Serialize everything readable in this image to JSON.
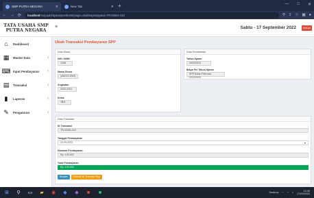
{
  "browser": {
    "tabs": [
      {
        "label": "SMP PUTRA NEGARA"
      },
      {
        "label": "New Tab"
      }
    ],
    "url_host": "localhost",
    "url_path": "/mejupdd/ajukanpnvtlnvtbr/page=ubahbayarspp&id=TR-00081-922",
    "icons": {
      "back": "←",
      "forward": "→",
      "reload": "⟳",
      "new_tab": "+",
      "minimize": "—",
      "maximize": "□",
      "close": "✕"
    }
  },
  "app": {
    "logo_line1": "TATA USAHA SMP",
    "logo_line2": "PUTRA NEGARA",
    "datetime": "Sabtu - 17 September 2022",
    "logout_label": "Keluar"
  },
  "sidebar": {
    "items": [
      {
        "label": "Dashboard",
        "icon": "home-icon"
      },
      {
        "label": "Master Data",
        "icon": "grid-icon"
      },
      {
        "label": "Input Pembayaran",
        "icon": "keyboard-icon"
      },
      {
        "label": "Transaksi",
        "icon": "money-icon"
      },
      {
        "label": "Laporan",
        "icon": "file-icon"
      },
      {
        "label": "Pengaturan",
        "icon": "wrench-icon"
      }
    ]
  },
  "main": {
    "title": "Ubah Transaksi Pembayaran SPP",
    "data_siswa": {
      "header": "Data Siswa",
      "nis_label": "NIS / NISN",
      "nis_value": "1248",
      "nama_label": "Nama Siswa",
      "nama_value": "(ANGGI DWI)",
      "angkatan_label": "Angkatan",
      "angkatan_value": "2020-2021",
      "kelas_label": "Kelas",
      "kelas_value": "7B/4"
    },
    "data_pendaftaran": {
      "header": "Data Pendaftaran",
      "tahun_label": "Tahun Ajaran",
      "tahun_value": "2022/2023",
      "biaya_label": "Biaya Per Tahun Ajaran",
      "biaya_value": "SPP Bulan Februari 2022/2023"
    },
    "data_transaksi": {
      "header": "Data Transaksi",
      "id_label": "ID Transaksi",
      "id_value": "TR-00081-922",
      "tanggal_label": "Tanggal Pembayaran",
      "tanggal_value": "22-09-2022",
      "nominal_label": "Nominal Pembayaran",
      "nominal_value": "Rp. 120.000",
      "total_label": "Total Pembayaran",
      "total_value": "Rp. 120.000",
      "btn_simpan": "Simpan",
      "btn_kembali": "Kembali ke Transaksi Spp"
    }
  },
  "taskbar": {
    "time": "10:49",
    "date": "17/09/2022",
    "tray_text": "Desktop"
  }
}
